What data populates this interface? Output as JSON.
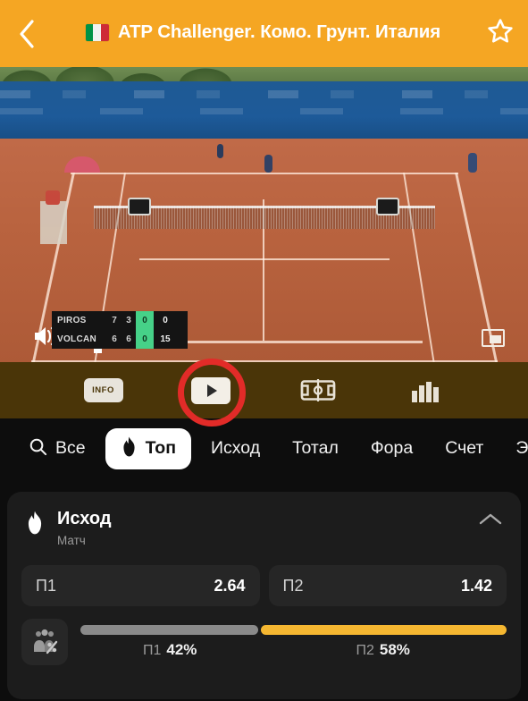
{
  "header": {
    "back_icon": "chevron-left-icon",
    "flag": "italy-flag-icon",
    "title": "ATP Challenger. Комо. Грунт. Италия",
    "favorite_icon": "star-outline-icon",
    "bg_color": "#f5a623"
  },
  "video": {
    "volume_icon": "volume-icon",
    "pause_icon": "pause-icon",
    "pip_icon": "picture-in-picture-icon",
    "scoreboard": {
      "rows": [
        {
          "name": "PIROS",
          "sets": [
            "7",
            "3"
          ],
          "games": "0",
          "points": "0"
        },
        {
          "name": "VOLCAN",
          "sets": [
            "6",
            "6"
          ],
          "games": "0",
          "points": "15"
        }
      ]
    }
  },
  "media_tabs": {
    "bg_color": "#4a3508",
    "items": [
      {
        "name": "info-tab",
        "label": "INFO",
        "icon": "info-icon",
        "active": false
      },
      {
        "name": "video-tab",
        "label": "",
        "icon": "play-icon",
        "active": true
      },
      {
        "name": "court-tab",
        "label": "",
        "icon": "court-icon",
        "active": false
      },
      {
        "name": "stats-tab",
        "label": "",
        "icon": "bar-chart-icon",
        "active": false
      }
    ],
    "highlight_color": "#e22b28"
  },
  "filters": {
    "search_icon": "search-icon",
    "tabs": [
      {
        "label": "Все",
        "icon": "search-icon",
        "active": false
      },
      {
        "label": "Топ",
        "icon": "flame-icon",
        "active": true
      },
      {
        "label": "Исход",
        "icon": "",
        "active": false
      },
      {
        "label": "Тотал",
        "icon": "",
        "active": false
      },
      {
        "label": "Фора",
        "icon": "",
        "active": false
      },
      {
        "label": "Счет",
        "icon": "",
        "active": false
      },
      {
        "label": "Эйсы",
        "icon": "",
        "active": false
      }
    ]
  },
  "bet_card": {
    "icon": "flame-icon",
    "title": "Исход",
    "subtitle": "Матч",
    "collapse_icon": "chevron-up-icon",
    "odds": [
      {
        "label": "П1",
        "value": "2.64"
      },
      {
        "label": "П2",
        "value": "1.42"
      }
    ],
    "probability": {
      "icon": "crowd-percent-icon",
      "left": {
        "label": "П1",
        "value": "42%",
        "pct": 42,
        "color": "#8a8a8a"
      },
      "right": {
        "label": "П2",
        "value": "58%",
        "pct": 58,
        "color": "#f5b731"
      }
    }
  }
}
